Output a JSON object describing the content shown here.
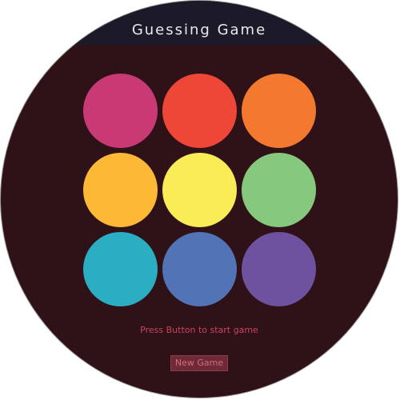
{
  "header": {
    "title": "Guessing Game"
  },
  "board": {
    "circles": [
      {
        "color": "#c93a74"
      },
      {
        "color": "#ee4637"
      },
      {
        "color": "#f2792e"
      },
      {
        "color": "#fdb835"
      },
      {
        "color": "#f9ec56"
      },
      {
        "color": "#86c87e"
      },
      {
        "color": "#2caec2"
      },
      {
        "color": "#5273b6"
      },
      {
        "color": "#6e52a0"
      }
    ]
  },
  "status": {
    "message": "Press Button to start game"
  },
  "controls": {
    "new_game_label": "New Game"
  }
}
